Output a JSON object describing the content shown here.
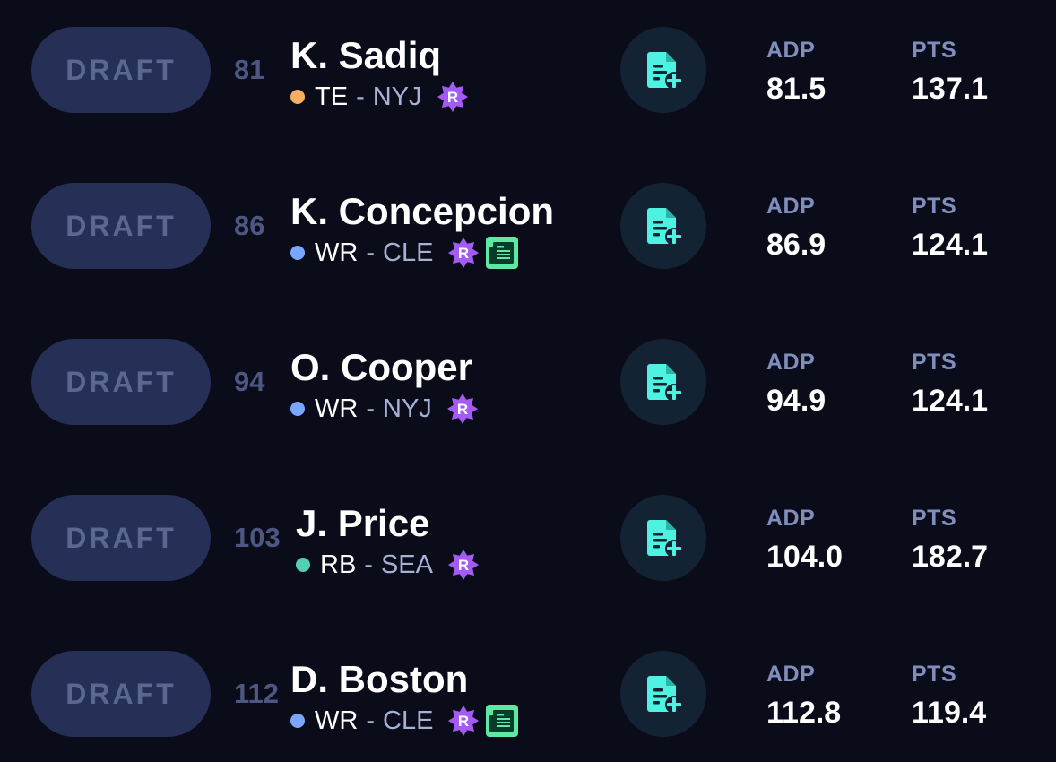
{
  "colors": {
    "background": "#0a0c1a",
    "draft_button_bg": "#262f55",
    "draft_button_text": "#5b6790",
    "accent_teal": "#4ef2e0",
    "rookie_purple": "#a45bf5",
    "news_green": "#5ee8a4",
    "position_TE": "#f4b05e",
    "position_WR": "#7aa6ff",
    "position_RB": "#52d0b0"
  },
  "players": [
    {
      "draft_label": "DRAFT",
      "rank": "81",
      "name": "K. Sadiq",
      "position": "TE",
      "separator": "-",
      "team": "NYJ",
      "rookie_badge": "R",
      "has_news": false,
      "adp_label": "ADP",
      "adp": "81.5",
      "pts_label": "PTS",
      "pts": "137.1",
      "dot_color": "#f4b05e",
      "icons": {
        "rookie": "rookie-badge-icon",
        "note": "add-note-icon"
      }
    },
    {
      "draft_label": "DRAFT",
      "rank": "86",
      "name": "K. Concepcion",
      "position": "WR",
      "separator": "-",
      "team": "CLE",
      "rookie_badge": "R",
      "has_news": true,
      "adp_label": "ADP",
      "adp": "86.9",
      "pts_label": "PTS",
      "pts": "124.1",
      "dot_color": "#7aa6ff",
      "icons": {
        "rookie": "rookie-badge-icon",
        "news": "news-icon",
        "note": "add-note-icon"
      }
    },
    {
      "draft_label": "DRAFT",
      "rank": "94",
      "name": "O. Cooper",
      "position": "WR",
      "separator": "-",
      "team": "NYJ",
      "rookie_badge": "R",
      "has_news": false,
      "adp_label": "ADP",
      "adp": "94.9",
      "pts_label": "PTS",
      "pts": "124.1",
      "dot_color": "#7aa6ff",
      "icons": {
        "rookie": "rookie-badge-icon",
        "note": "add-note-icon"
      }
    },
    {
      "draft_label": "DRAFT",
      "rank": "103",
      "name": "J. Price",
      "position": "RB",
      "separator": "-",
      "team": "SEA",
      "rookie_badge": "R",
      "has_news": false,
      "adp_label": "ADP",
      "adp": "104.0",
      "pts_label": "PTS",
      "pts": "182.7",
      "dot_color": "#52d0b0",
      "icons": {
        "rookie": "rookie-badge-icon",
        "note": "add-note-icon"
      }
    },
    {
      "draft_label": "DRAFT",
      "rank": "112",
      "name": "D. Boston",
      "position": "WR",
      "separator": "-",
      "team": "CLE",
      "rookie_badge": "R",
      "has_news": true,
      "adp_label": "ADP",
      "adp": "112.8",
      "pts_label": "PTS",
      "pts": "119.4",
      "dot_color": "#7aa6ff",
      "icons": {
        "rookie": "rookie-badge-icon",
        "news": "news-icon",
        "note": "add-note-icon"
      }
    }
  ]
}
